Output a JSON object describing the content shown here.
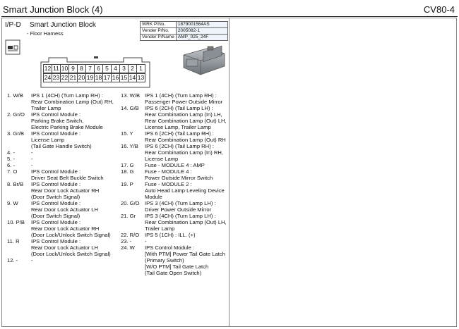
{
  "header": {
    "title": "Smart Junction Block (4)",
    "code": "CV80-4"
  },
  "connector": {
    "location": "I/P-D",
    "name": "Smart Junction Block",
    "harness": "- Floor Harness",
    "info": [
      {
        "key": "WRK P/No.",
        "value": "1879001564AS"
      },
      {
        "key": "Vender P/No.",
        "value": "2005082-1"
      },
      {
        "key": "Vender P/Name",
        "value": "AMP_025_24F"
      }
    ],
    "pin_top": [
      "12",
      "11",
      "10",
      "9",
      "8",
      "7",
      "6",
      "5",
      "4",
      "3",
      "2",
      "1"
    ],
    "pin_bottom": [
      "24",
      "23",
      "22",
      "21",
      "20",
      "19",
      "18",
      "17",
      "16",
      "15",
      "14",
      "13"
    ]
  },
  "pins_left": [
    {
      "num": "1. W/B",
      "desc": "IPS 1 (4CH) (Turn Lamp RH) :\nRear Combination Lamp (Out) RH,\nTrailer Lamp"
    },
    {
      "num": "2. Gr/O",
      "desc": "IPS Control Module :\nParking Brake Switch,\nElectric Parking Brake Module"
    },
    {
      "num": "3. Gr/B",
      "desc": "IPS Control Module :\nLicense Lamp\n(Tail Gate Handle Switch)"
    },
    {
      "num": "4. -",
      "desc": "-"
    },
    {
      "num": "5. -",
      "desc": "-"
    },
    {
      "num": "6. -",
      "desc": "-"
    },
    {
      "num": "7. O",
      "desc": "IPS Control Module :\nDriver Seat Belt Buckle Switch"
    },
    {
      "num": "8. Br/B",
      "desc": "IPS Control Module :\nRear Door Lock Actuator RH\n(Door Switch Signal)"
    },
    {
      "num": "9. W",
      "desc": "IPS Control Module :\nRear Door Lock Actuator LH\n(Door Switch Signal)"
    },
    {
      "num": "10. P/B",
      "desc": "IPS Control Module :\nRear Door Lock Actuator RH\n(Door Lock/Unlock Switch Signal)"
    },
    {
      "num": "11. R",
      "desc": "IPS Control Module :\nRear Door Lock Actuator LH\n(Door Lock/Unlock Switch Signal)"
    },
    {
      "num": "12. -",
      "desc": "-"
    }
  ],
  "pins_right": [
    {
      "num": "13. W/B",
      "desc": "IPS 1 (4CH) (Turn Lamp RH) :\nPassenger Power Outside Mirror"
    },
    {
      "num": "14. G/B",
      "desc": "IPS 6 (2CH) (Tail Lamp LH) :\nRear Combination Lamp (In) LH,\nRear Combination Lamp (Out) LH,\nLicense Lamp, Trailer Lamp"
    },
    {
      "num": "15. Y",
      "desc": "IPS 6 (2CH) (Tail Lamp RH) :\nRear Combination Lamp (Out) RH"
    },
    {
      "num": "16. Y/B",
      "desc": "IPS 6 (2CH) (Tail Lamp RH) :\nRear Combination Lamp (In) RH,\nLicense Lamp"
    },
    {
      "num": "17. G",
      "desc": "Fuse - MODULE 4 : AMP"
    },
    {
      "num": "18. G",
      "desc": "Fuse - MODULE 4 :\nPower Outside Mirror Switch"
    },
    {
      "num": "19. P",
      "desc": "Fuse - MODULE 2 :\nAuto Head Lamp Leveling Device\nModule"
    },
    {
      "num": "20. G/O",
      "desc": "IPS 3 (4CH) (Turn Lamp LH) :\nDriver Power Outside Mirror"
    },
    {
      "num": "21. Gr",
      "desc": "IPS 3 (4CH) (Turn Lamp LH) :\nRear Combination Lamp (Out) LH,\nTrailer Lamp"
    },
    {
      "num": "22. R/O",
      "desc": "IPS 5 (1CH) : ILL. (+)"
    },
    {
      "num": "23. -",
      "desc": "-"
    },
    {
      "num": "24. W",
      "desc": "IPS Control Module :\n[With PTM] Power Tail Gate Latch\n(Primary Switch)\n[W/O PTM] Tail Gate Latch\n(Tail Gate Open Switch)"
    }
  ]
}
